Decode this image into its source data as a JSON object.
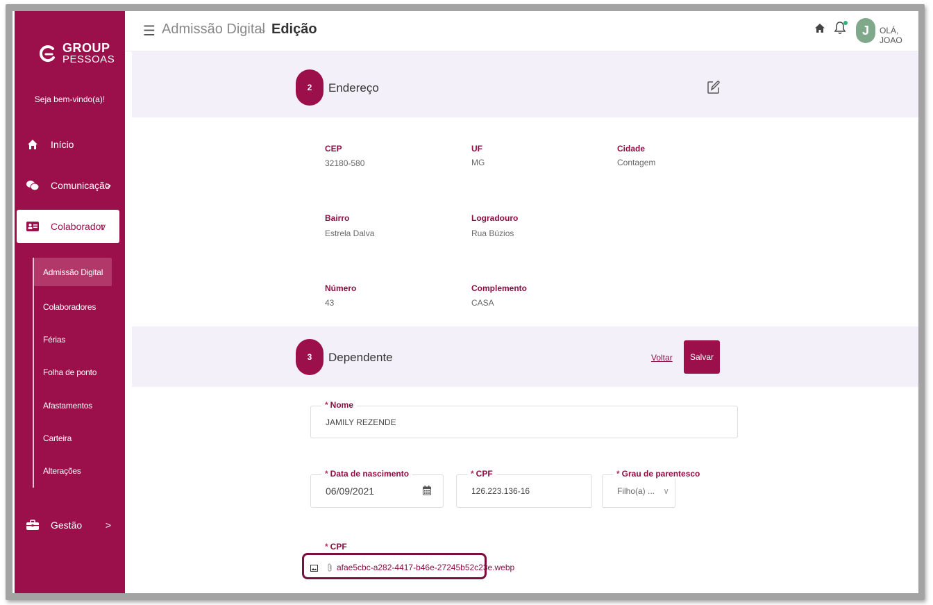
{
  "sidebar": {
    "logo_top": "GROUP",
    "logo_bottom": "PESSOAS",
    "welcome": "Seja bem-vindo(a)!",
    "items": [
      {
        "label": "Início",
        "icon": "home-icon"
      },
      {
        "label": "Comunicação",
        "icon": "chat-icon",
        "chevron": ">"
      },
      {
        "label": "Colaborador",
        "icon": "id-card-icon",
        "chevron": "v"
      },
      {
        "label": "Gestão",
        "icon": "briefcase-icon",
        "chevron": ">"
      }
    ],
    "subitems": [
      {
        "label": "Admissão Digital"
      },
      {
        "label": "Colaboradores"
      },
      {
        "label": "Férias"
      },
      {
        "label": "Folha de ponto"
      },
      {
        "label": "Afastamentos"
      },
      {
        "label": "Carteira"
      },
      {
        "label": "Alterações"
      }
    ]
  },
  "topbar": {
    "menu_icon": "☰",
    "breadcrumb_1": "Admissão Digital",
    "breadcrumb_sep": ">",
    "breadcrumb_2": "Edição",
    "avatar_letter": "J",
    "greeting": "OLÁ, JOAO"
  },
  "address": {
    "step": "2",
    "title": "Endereço",
    "fields": {
      "cep_label": "CEP",
      "cep": "32180-580",
      "uf_label": "UF",
      "uf": "MG",
      "cidade_label": "Cidade",
      "cidade": "Contagem",
      "bairro_label": "Bairro",
      "bairro": "Estrela Dalva",
      "logradouro_label": "Logradouro",
      "logradouro": "Rua Búzios",
      "numero_label": "Número",
      "numero": "43",
      "complemento_label": "Complemento",
      "complemento": "CASA"
    }
  },
  "dependent": {
    "step": "3",
    "title": "Dependente",
    "back_label": "Voltar",
    "save_label": "Salvar",
    "required_mark": "*",
    "nome_label": "Nome",
    "nome_value": "JAMILY REZENDE",
    "nascimento_label": "Data de nascimento",
    "nascimento_value": "06/09/2021",
    "cpf_label": "CPF",
    "cpf_value": "126.223.136-16",
    "parentesco_label": "Grau de parentesco",
    "parentesco_value": "Filho(a) ...",
    "parentesco_chevron": "∨",
    "cpf_file_label": "CPF",
    "cpf_file_name": "afae5cbc-a282-4417-b46e-27245b52c23e.webp"
  },
  "colors": {
    "brand": "#9b0f4b",
    "band": "#f4f0f9",
    "online_dot": "#2ab27b"
  }
}
